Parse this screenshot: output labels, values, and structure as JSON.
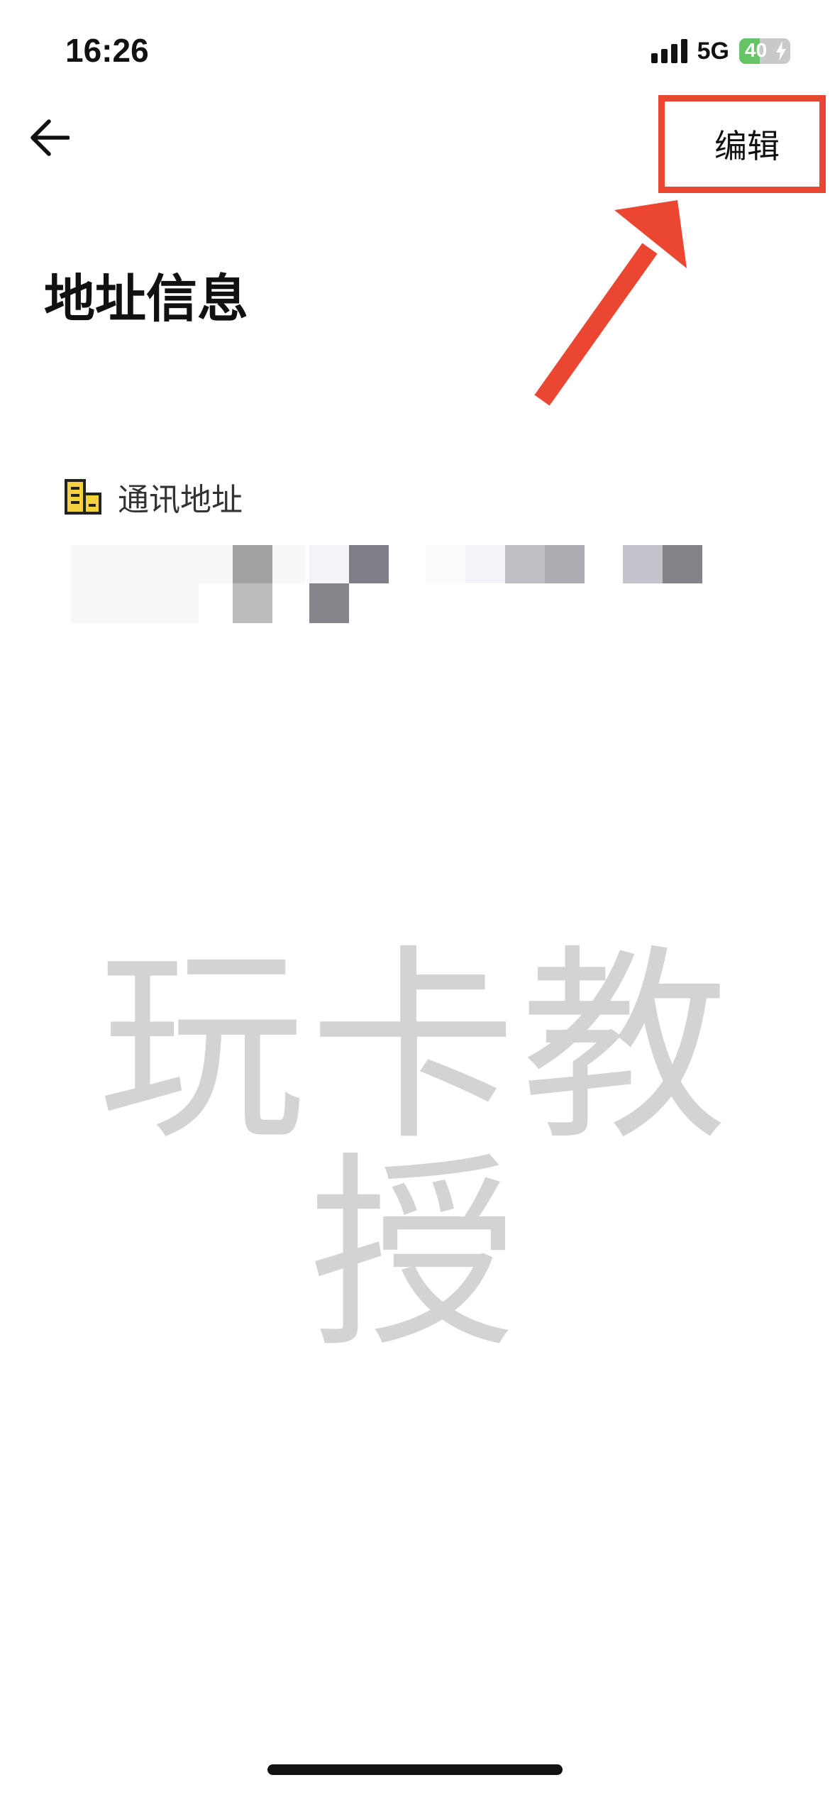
{
  "status_bar": {
    "time": "16:26",
    "network": "5G",
    "battery_percent": "40",
    "battery_level": 0.4,
    "battery_color": "#65c466"
  },
  "nav": {
    "back_icon": "arrow-left-icon",
    "edit_label": "编辑"
  },
  "page": {
    "title": "地址信息"
  },
  "section": {
    "icon": "building-icon",
    "label": "通讯地址",
    "value_redacted": true
  },
  "watermark": {
    "text": "玩卡教授"
  },
  "annotation": {
    "color": "#ea4631",
    "target": "edit-button"
  }
}
